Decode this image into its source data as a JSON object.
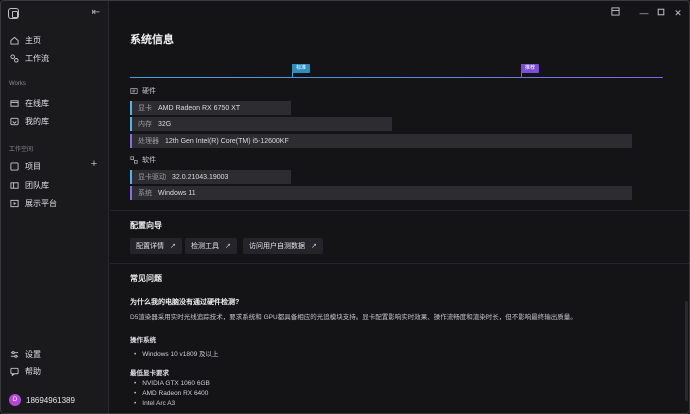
{
  "sidebar": {
    "nav_top": [
      {
        "label": "主页",
        "icon": "home-icon"
      },
      {
        "label": "工作流",
        "icon": "workflow-icon"
      }
    ],
    "works_label": "Works",
    "works_items": [
      {
        "label": "在线库",
        "icon": "online-library-icon"
      },
      {
        "label": "我的库",
        "icon": "my-library-icon"
      }
    ],
    "workspace_label": "工作空间",
    "workspace_items": [
      {
        "label": "项目",
        "icon": "project-icon"
      },
      {
        "label": "团队库",
        "icon": "team-library-icon"
      },
      {
        "label": "展示平台",
        "icon": "showcase-icon"
      }
    ],
    "bottom_items": [
      {
        "label": "设置",
        "icon": "settings-icon"
      },
      {
        "label": "帮助",
        "icon": "help-icon"
      }
    ],
    "user": {
      "initial": "D",
      "name": "18694961389",
      "avatar_color": "#b347d9"
    }
  },
  "main": {
    "title": "系统信息",
    "markers": [
      {
        "label": "标准",
        "color": "#3aa6d8"
      },
      {
        "label": "推荐",
        "color": "#8a5fe8"
      }
    ],
    "hardware": {
      "heading": "硬件",
      "rows": [
        {
          "key": "显卡",
          "value": "AMD Radeon RX 6750 XT"
        },
        {
          "key": "内存",
          "value": "32G"
        },
        {
          "key": "处理器",
          "value": "12th Gen Intel(R) Core(TM) i5-12600KF"
        }
      ]
    },
    "software": {
      "heading": "软件",
      "rows": [
        {
          "key": "显卡驱动",
          "value": "32.0.21043.19003"
        },
        {
          "key": "系统",
          "value": "Windows 11"
        }
      ]
    },
    "config_guide": {
      "heading": "配置向导",
      "buttons": [
        "配置详情",
        "检测工具",
        "访问用户自测数据"
      ]
    },
    "faq": {
      "heading": "常见问题",
      "question": "为什么我的电脑没有通过硬件检测?",
      "answer": "D5渲染器采用实时光线追踪技术，要求系统和 GPU都具备相应的光追模块支持。显卡配置影响实时效果、操作流畅度和渲染时长，但不影响最终输出质量。",
      "os_heading": "操作系统",
      "os_items": [
        "Windows 10 v1809 及以上"
      ],
      "gpu_heading": "最低显卡要求",
      "gpu_items": [
        "NVIDIA GTX 1060 6GB",
        "AMD Radeon RX 6400",
        "Intel Arc A3"
      ]
    }
  }
}
